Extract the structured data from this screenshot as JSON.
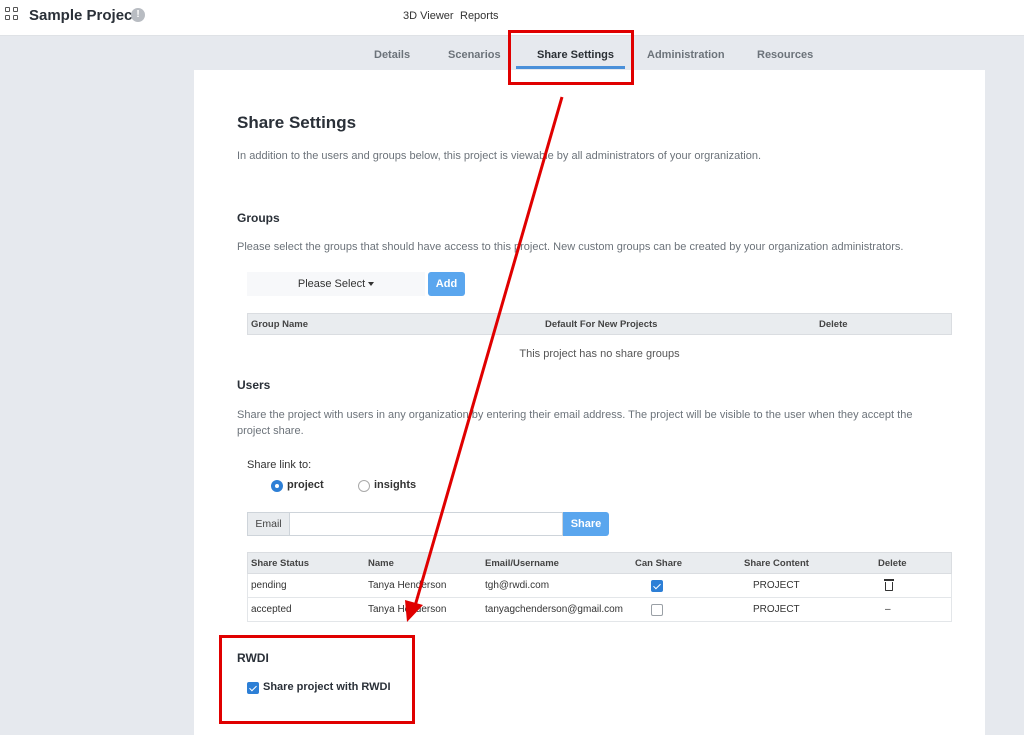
{
  "header": {
    "project_title": "Sample Project",
    "nav": [
      "3D Viewer",
      "Reports"
    ]
  },
  "tabs": [
    "Details",
    "Scenarios",
    "Share Settings",
    "Administration",
    "Resources"
  ],
  "page": {
    "title": "Share Settings",
    "intro": "In addition to the users and groups below, this project is viewable by all administrators of your orgranization."
  },
  "groups": {
    "heading": "Groups",
    "description": "Please select the groups that should have access to this project. New custom groups can be created by your organization administrators.",
    "select_label": "Please Select",
    "add_label": "Add",
    "columns": [
      "Group Name",
      "Default For New Projects",
      "Delete"
    ],
    "empty_text": "This project has no share groups"
  },
  "users": {
    "heading": "Users",
    "description_line1": "Share the project with users in any organization by entering their email address. The project will be visible to the user when they accept the",
    "description_line2": "project share.",
    "share_link_label": "Share link to:",
    "radio_options": [
      "project",
      "insights"
    ],
    "selected_option": "project",
    "email_addon": "Email",
    "email_value": "",
    "share_label": "Share",
    "columns": [
      "Share Status",
      "Name",
      "Email/Username",
      "Can Share",
      "Share Content",
      "Delete"
    ],
    "rows": [
      {
        "status": "pending",
        "name": "Tanya Henderson",
        "email": "tgh@rwdi.com",
        "can_share": true,
        "content": "PROJECT",
        "delete": "trash-icon"
      },
      {
        "status": "accepted",
        "name": "Tanya Henderson",
        "email": "tanyagchenderson@gmail.com",
        "can_share": false,
        "content": "PROJECT",
        "delete": "–"
      }
    ]
  },
  "rwdi": {
    "heading": "RWDI",
    "checkbox_label": "Share project with RWDI",
    "checked": true
  },
  "colors": {
    "annotation": "#e00000",
    "accent": "#2d7fd6",
    "button": "#5aa6ee"
  }
}
